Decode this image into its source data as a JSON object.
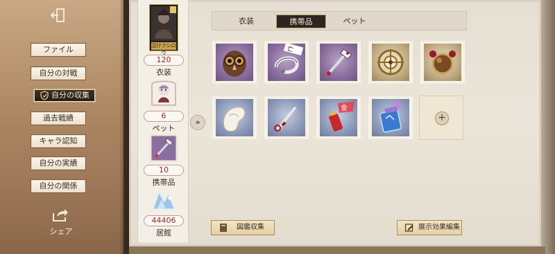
{
  "sidebar": {
    "items": [
      {
        "label": "ファイル"
      },
      {
        "label": "自分の対戦"
      },
      {
        "label": "自分の収集"
      },
      {
        "label": "過去戦績"
      },
      {
        "label": "キャラ認知"
      },
      {
        "label": "自分の実績"
      },
      {
        "label": "自分の関係"
      }
    ],
    "active_index": 2,
    "share_label": "シェア"
  },
  "stats": {
    "portrait_caption": "泣けフシロウ",
    "items": [
      {
        "value": "120",
        "label": "衣装",
        "icon": "costume-portrait-icon"
      },
      {
        "value": "6",
        "label": "ペット",
        "icon": "pet-icon"
      },
      {
        "value": "10",
        "label": "携帯品",
        "icon": "accessory-icon"
      },
      {
        "value": "44406",
        "label": "居館",
        "icon": "residence-icon"
      }
    ]
  },
  "tabs": [
    {
      "label": "衣装"
    },
    {
      "label": "携帯品"
    },
    {
      "label": "ペット"
    }
  ],
  "active_tab": 1,
  "grid": {
    "items": [
      {
        "icon": "owl-mask-icon",
        "frame": "purple"
      },
      {
        "icon": "seal-charm-icon",
        "frame": "purple",
        "tag": "亡"
      },
      {
        "icon": "ornate-wand-icon",
        "frame": "purple"
      },
      {
        "icon": "compass-wheel-icon",
        "frame": "gold"
      },
      {
        "icon": "ornament-ball-icon",
        "frame": "gold"
      },
      {
        "icon": "white-cloth-icon",
        "frame": "blue"
      },
      {
        "icon": "scissors-blade-icon",
        "frame": "blue"
      },
      {
        "icon": "red-lantern-icon",
        "frame": "blue",
        "tag": "金"
      },
      {
        "icon": "crystal-jar-icon",
        "frame": "blue"
      }
    ],
    "add_symbol": "+"
  },
  "buttons": {
    "codex_label": "図鑑収集",
    "display_edit_label": "展示効果編集"
  },
  "colors": {
    "accent_red": "#9b2b2b",
    "active_tab_bg": "#2d2620",
    "sidebar_bg": "#b08a66"
  }
}
